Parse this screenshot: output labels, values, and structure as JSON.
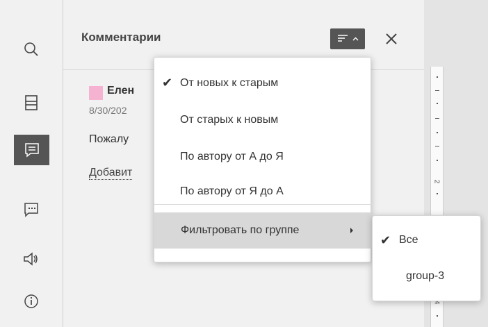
{
  "sidebar": {
    "items": [
      {
        "name": "search-icon"
      },
      {
        "name": "headings-icon"
      },
      {
        "name": "comments-icon",
        "active": true
      },
      {
        "name": "chat-icon"
      },
      {
        "name": "feedback-icon"
      },
      {
        "name": "about-icon"
      }
    ]
  },
  "panel": {
    "title": "Комментарии",
    "sort_button_icon": "sort-icon",
    "close_icon": "close-icon"
  },
  "comment": {
    "author": "Елен",
    "author_color": "#f5b3d1",
    "date": "8/30/202",
    "text": "Пожалу",
    "add_reply": "Добавит"
  },
  "sort_menu": {
    "items": [
      {
        "label": "От новых к старым",
        "checked": true
      },
      {
        "label": "От старых к новым",
        "checked": false
      },
      {
        "label": "По автору от А до Я",
        "checked": false
      },
      {
        "label": "По автору от Я до А",
        "checked": false
      }
    ],
    "filter_label": "Фильтровать по группе",
    "check_glyph": "✔"
  },
  "filter_submenu": {
    "items": [
      {
        "label": "Все",
        "checked": true
      },
      {
        "label": "group-3",
        "checked": false
      }
    ]
  },
  "ruler": {
    "labels": [
      "2",
      "4"
    ]
  },
  "colors": {
    "active_button": "#555555",
    "panel_bg": "#f1f1f1",
    "menu_highlight": "#d8d8d8"
  }
}
